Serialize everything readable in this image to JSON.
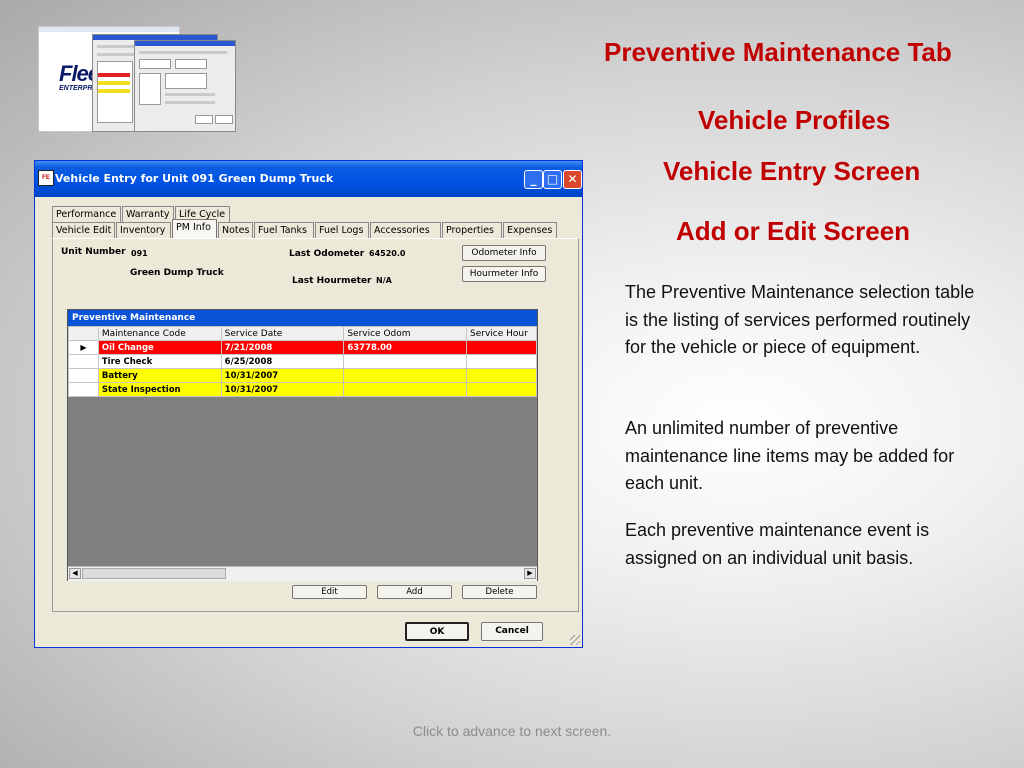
{
  "slide": {
    "headings": [
      "Preventive Maintenance Tab",
      "Vehicle Profiles",
      "Vehicle Entry Screen",
      "Add or Edit Screen"
    ],
    "paragraphs": [
      "The Preventive Maintenance selection table is the listing of services performed routinely for the vehicle or piece of equipment.",
      "An unlimited number of preventive maintenance line items may be added for each unit.",
      "Each preventive maintenance event is assigned on an individual unit basis."
    ],
    "footer": "Click to advance to next screen.",
    "thumb_logo": "Flee",
    "thumb_logo_sub": "ENTERPRISI"
  },
  "window": {
    "title": "Vehicle Entry for Unit 091 Green Dump Truck",
    "icon_text": "FE",
    "tabs_row1": [
      "Performance",
      "Warranty",
      "Life Cycle"
    ],
    "tabs_row2": [
      "Vehicle Edit",
      "Inventory",
      "PM Info",
      "Notes",
      "Fuel Tanks",
      "Fuel Logs",
      "Accessories",
      "Properties",
      "Expenses"
    ],
    "active_tab": "PM Info",
    "unit_number_label": "Unit Number",
    "unit_number": "091",
    "unit_description": "Green Dump Truck",
    "last_odometer_label": "Last Odometer",
    "last_odometer": "64520.0",
    "last_hourmeter_label": "Last Hourmeter",
    "last_hourmeter": "N/A",
    "odometer_button": "Odometer Info",
    "hourmeter_button": "Hourmeter Info",
    "grid": {
      "caption": "Preventive Maintenance",
      "columns": [
        "Maintenance Code",
        "Service Date",
        "Service Odom",
        "Service Hour"
      ],
      "rows": [
        {
          "code": "Oil Change",
          "date": "7/21/2008",
          "odom": "63778.00",
          "hour": "",
          "color": "red"
        },
        {
          "code": "Tire Check",
          "date": "6/25/2008",
          "odom": "",
          "hour": "",
          "color": "white"
        },
        {
          "code": "Battery",
          "date": "10/31/2007",
          "odom": "",
          "hour": "",
          "color": "yellow"
        },
        {
          "code": "State Inspection",
          "date": "10/31/2007",
          "odom": "",
          "hour": "",
          "color": "yellow"
        }
      ],
      "row_marker": "▶"
    },
    "edit_button": "Edit",
    "add_button": "Add",
    "delete_button": "Delete",
    "ok_button": "OK",
    "cancel_button": "Cancel",
    "minimize_glyph": "_",
    "maximize_glyph": "□",
    "close_glyph": "✕",
    "scroll_left_glyph": "◀",
    "scroll_right_glyph": "▶"
  },
  "colors": {
    "heading": "#c00000",
    "titlebar": "#0054e3",
    "grid_caption": "#0b53d6",
    "row_red": "#ff0000",
    "row_yellow": "#ffff00"
  }
}
